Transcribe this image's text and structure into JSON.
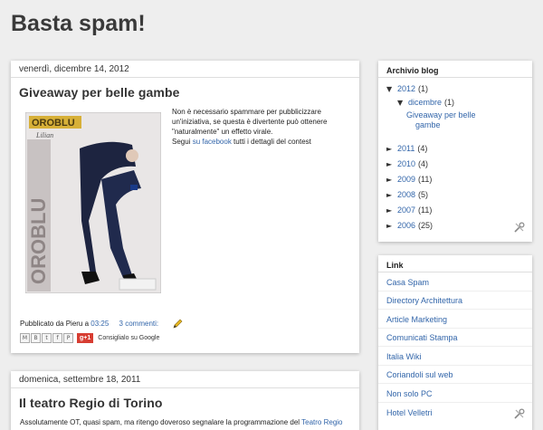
{
  "blog": {
    "title": "Basta spam!"
  },
  "posts": [
    {
      "date": "venerdì, dicembre 14, 2012",
      "title": "Giveaway per belle gambe",
      "body_line1": "Non è necessario spammare per pubblicizzare",
      "body_line2": "un'iniziativa, se questa è divertente può ottenere",
      "body_line3": "\"naturalmente\" un effetto virale.",
      "body_line4_prefix": "Segui ",
      "body_line4_link": "su facebook",
      "body_line4_suffix": " tutti i dettagli del contest",
      "image": {
        "brand": "OROBLU",
        "product": "Lilian"
      },
      "footer_prefix": "Pubblicato da Pieru a ",
      "footer_time": "03:25",
      "footer_comments": "3 commenti:",
      "share_label": "Consiglialo su Google",
      "share_icons": [
        "M",
        "B",
        "t",
        "f",
        "P"
      ],
      "gplus_label": "g+1"
    },
    {
      "date": "domenica, settembre 18, 2011",
      "title": "Il teatro Regio di Torino",
      "body_prefix": "Assolutamente OT, quasi spam, ma ritengo doveroso segnalare la programmazione del ",
      "body_link": "Teatro Regio"
    }
  ],
  "archive": {
    "title": "Archivio blog",
    "years": [
      {
        "year": "2012",
        "count": "(1)",
        "expanded": true
      },
      {
        "year": "2011",
        "count": "(4)"
      },
      {
        "year": "2010",
        "count": "(4)"
      },
      {
        "year": "2009",
        "count": "(11)"
      },
      {
        "year": "2008",
        "count": "(5)"
      },
      {
        "year": "2007",
        "count": "(11)"
      },
      {
        "year": "2006",
        "count": "(25)"
      }
    ],
    "month": {
      "name": "dicembre",
      "count": "(1)"
    },
    "post_line1": "Giveaway per belle",
    "post_line2": "gambe"
  },
  "links": {
    "title": "Link",
    "items": [
      "Casa Spam",
      "Directory Architettura",
      "Article Marketing",
      "Comunicati Stampa",
      "Italia Wiki",
      "Coriandoli sul web",
      "Non solo PC",
      "Hotel Velletri"
    ]
  },
  "colors": {
    "link": "#3366aa",
    "background": "#eeeeee",
    "panel": "#ffffff"
  },
  "icons": {
    "edit": "pencil-icon",
    "tools": "wrench-screwdriver-icon"
  }
}
